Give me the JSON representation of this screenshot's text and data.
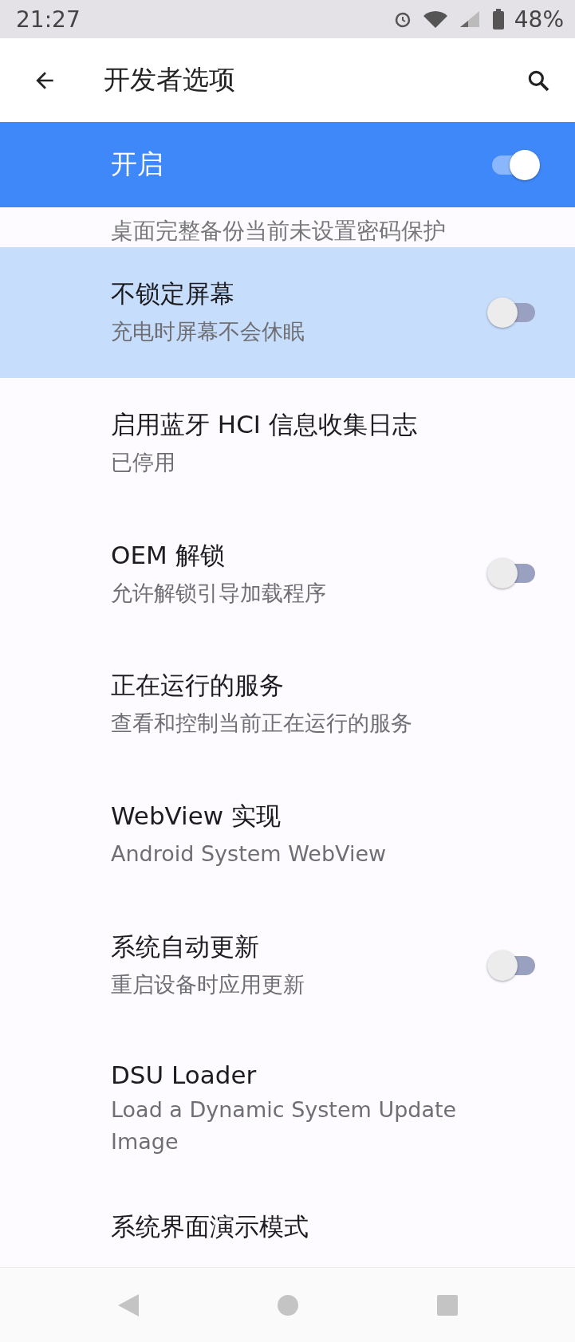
{
  "status_bar": {
    "time": "21:27",
    "battery": "48%"
  },
  "toolbar": {
    "title": "开发者选项"
  },
  "main_switch": {
    "label": "开启",
    "on": true
  },
  "partial_row": {
    "subtitle": "桌面完整备份当前未设置密码保护"
  },
  "rows": [
    {
      "kind": "switch",
      "title": "不锁定屏幕",
      "subtitle": "充电时屏幕不会休眠",
      "on": false,
      "highlighted": true
    },
    {
      "kind": "plain",
      "title": "启用蓝牙 HCI 信息收集日志",
      "subtitle": "已停用",
      "highlighted": false
    },
    {
      "kind": "switch",
      "title": "OEM 解锁",
      "subtitle": "允许解锁引导加载程序",
      "on": false,
      "highlighted": false
    },
    {
      "kind": "plain",
      "title": "正在运行的服务",
      "subtitle": "查看和控制当前正在运行的服务",
      "highlighted": false
    },
    {
      "kind": "plain",
      "title": "WebView 实现",
      "subtitle": "Android System WebView",
      "highlighted": false
    },
    {
      "kind": "switch",
      "title": "系统自动更新",
      "subtitle": "重启设备时应用更新",
      "on": false,
      "highlighted": false
    },
    {
      "kind": "plain",
      "title": "DSU Loader",
      "subtitle": "Load a Dynamic System Update Image",
      "highlighted": false
    },
    {
      "kind": "plain",
      "title": "系统界面演示模式",
      "highlighted": false
    }
  ]
}
